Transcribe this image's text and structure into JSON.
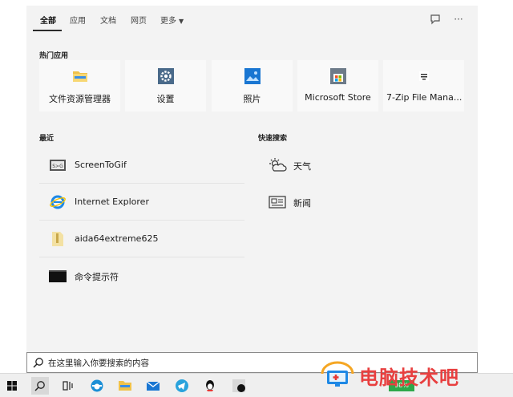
{
  "tabs": [
    {
      "label": "全部",
      "active": true
    },
    {
      "label": "应用"
    },
    {
      "label": "文档"
    },
    {
      "label": "网页"
    },
    {
      "label": "更多"
    }
  ],
  "top_apps": {
    "heading": "热门应用",
    "items": [
      {
        "label": "文件资源管理器",
        "icon": "folder-icon"
      },
      {
        "label": "设置",
        "icon": "gear-icon"
      },
      {
        "label": "照片",
        "icon": "photos-icon"
      },
      {
        "label": "Microsoft Store",
        "icon": "store-icon"
      },
      {
        "label": "7-Zip File Mana...",
        "icon": "7zip-icon"
      }
    ]
  },
  "recent": {
    "heading": "最近",
    "items": [
      {
        "label": "ScreenToGif",
        "icon": "screentogif-icon"
      },
      {
        "label": "Internet Explorer",
        "icon": "ie-icon"
      },
      {
        "label": "aida64extreme625",
        "icon": "zip-folder-icon"
      },
      {
        "label": "命令提示符",
        "icon": "cmd-icon"
      }
    ]
  },
  "quick_search": {
    "heading": "快速搜索",
    "items": [
      {
        "label": "天气",
        "icon": "weather-icon"
      },
      {
        "label": "新闻",
        "icon": "news-icon"
      }
    ]
  },
  "search": {
    "value": "在这里输入你要搜索的内容"
  },
  "taskbar": {
    "items": [
      "start-icon",
      "search-icon",
      "task-view-icon",
      "edge-icon",
      "explorer-icon",
      "mail-icon",
      "telegram-icon",
      "qq-icon",
      "app-icon"
    ],
    "battery_badge": "98%"
  },
  "watermark": {
    "text": "电脑技术吧"
  },
  "colors": {
    "panel": "#f3f3f3",
    "tile": "#f9f9f9",
    "accent": "#0078d4",
    "watermark": "#e83f3f"
  }
}
